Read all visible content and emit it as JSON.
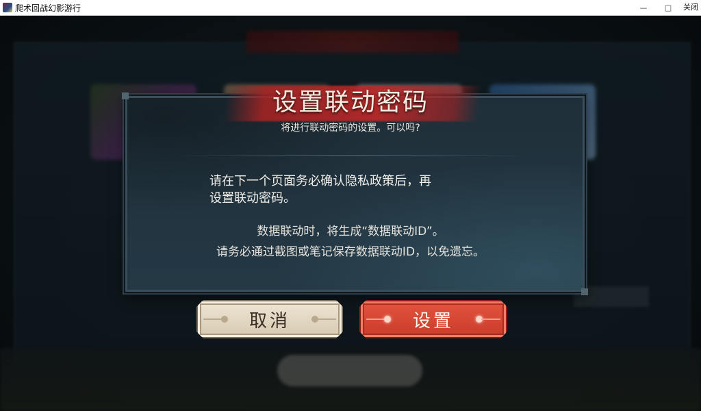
{
  "window": {
    "title": "爬术回战幻影游行",
    "minimize_glyph": "—",
    "maximize_glyph": "□",
    "close_label": "关闭"
  },
  "dialog": {
    "title": "设置联动密码",
    "subtitle": "将进行联动密码的设置。可以吗?",
    "body_line_1": "请在下一个页面务必确认隐私政策后，再",
    "body_line_2": "设置联动密码。",
    "note_line_1": "数据联动时，将生成“数据联动ID”。",
    "note_line_2": "请务必通过截图或笔记保存数据联动ID，以免遗忘。"
  },
  "buttons": {
    "cancel_label": "取消",
    "set_label": "设置"
  },
  "colors": {
    "accent_red": "#c93b2a",
    "cancel_beige": "#e3d8c2",
    "dialog_bg": "#213440"
  }
}
